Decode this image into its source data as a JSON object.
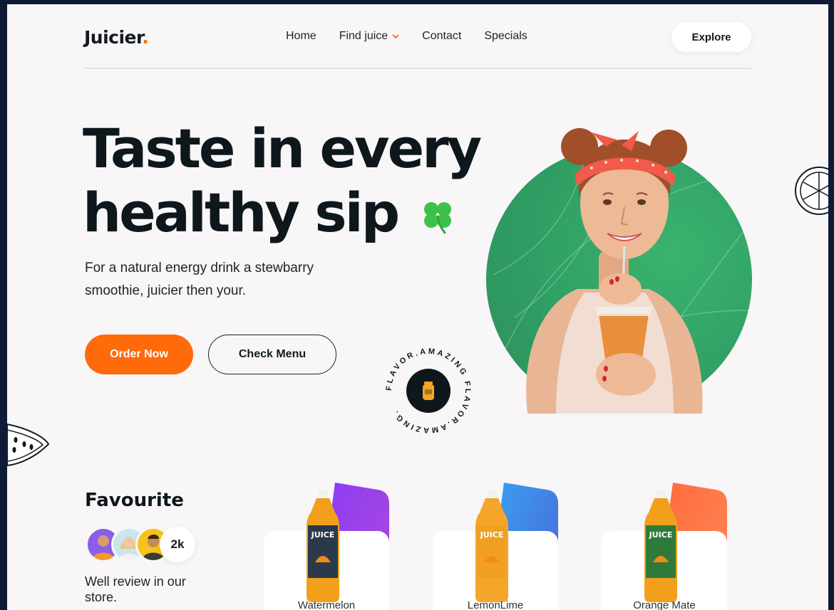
{
  "brand": {
    "name": "Juicier",
    "dot": ".",
    "accent": "#ff6a00"
  },
  "nav": {
    "items": [
      {
        "label": "Home"
      },
      {
        "label": "Find juice",
        "has_dropdown": true
      },
      {
        "label": "Contact"
      },
      {
        "label": "Specials"
      }
    ],
    "explore_label": "Explore"
  },
  "hero": {
    "title_line1": "Taste in every",
    "title_line2": "healthy sip",
    "subtitle": "For a natural energy drink a stewbarry smoothie, juicier then your.",
    "order_label": "Order Now",
    "menu_label": "Check Menu",
    "badge_text": "FLAVOR.AMAZING FLAVOR.AMAZING.",
    "circle_color": "#35a866"
  },
  "favourite": {
    "title": "Favourite",
    "review_count": "2k",
    "review_text": "Well review in our store."
  },
  "products": [
    {
      "name": "Watermelon",
      "label_color": "#2a3a4a",
      "accent_from": "#8b3df5",
      "accent_to": "#b04ad8"
    },
    {
      "name": "LemonLime",
      "label_color": "#2a3a4a",
      "accent_from": "#3aa0f0",
      "accent_to": "#4a62d8"
    },
    {
      "name": "Orange Mate",
      "label_color": "#2f7a3a",
      "accent_from": "#ff6a3a",
      "accent_to": "#ff8a5a"
    }
  ],
  "colors": {
    "primary": "#ff6a0b",
    "dark": "#0e171c",
    "background": "#f8f6f7"
  }
}
